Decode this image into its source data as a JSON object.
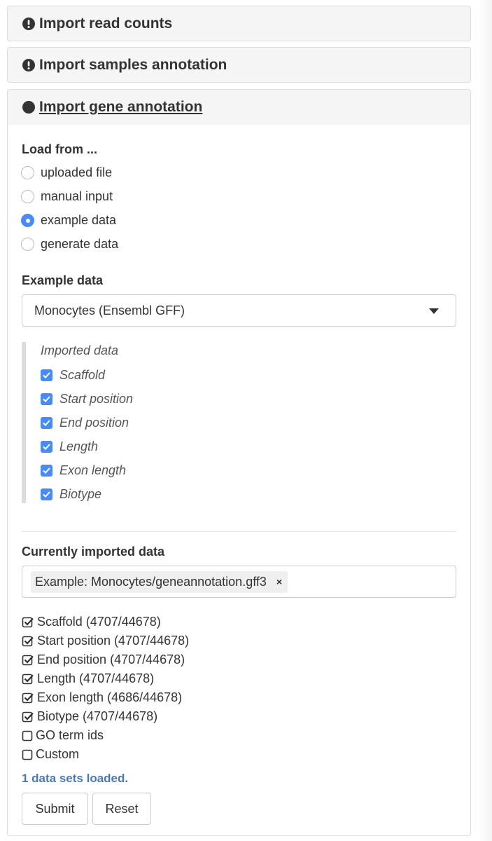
{
  "panels": {
    "read_counts": {
      "title": "Import read counts"
    },
    "samples": {
      "title": "Import samples annotation"
    },
    "gene": {
      "title": "Import gene annotation"
    }
  },
  "load_from": {
    "label": "Load from ...",
    "options": [
      "uploaded file",
      "manual input",
      "example data",
      "generate data"
    ],
    "selected": "example data"
  },
  "example": {
    "label": "Example data",
    "selected": "Monocytes (Ensembl GFF)",
    "imported_title": "Imported data",
    "items": [
      "Scaffold",
      "Start position",
      "End position",
      "Length",
      "Exon length",
      "Biotype"
    ]
  },
  "current": {
    "label": "Currently imported data",
    "tag": "Example: Monocytes/geneannotation.gff3",
    "tag_remove": "×",
    "status": [
      {
        "text": "Scaffold (4707/44678)",
        "checked": true
      },
      {
        "text": "Start position (4707/44678)",
        "checked": true
      },
      {
        "text": "End position (4707/44678)",
        "checked": true
      },
      {
        "text": "Length (4707/44678)",
        "checked": true
      },
      {
        "text": "Exon length (4686/44678)",
        "checked": true
      },
      {
        "text": "Biotype (4707/44678)",
        "checked": true
      },
      {
        "text": "GO term ids",
        "checked": false
      },
      {
        "text": "Custom",
        "checked": false
      }
    ],
    "loaded_msg": "1 data sets loaded."
  },
  "buttons": {
    "submit": "Submit",
    "reset": "Reset"
  },
  "colors": {
    "accent": "#4a8af4",
    "info_text": "#4a78b5",
    "panel_bg": "#f5f5f5"
  }
}
